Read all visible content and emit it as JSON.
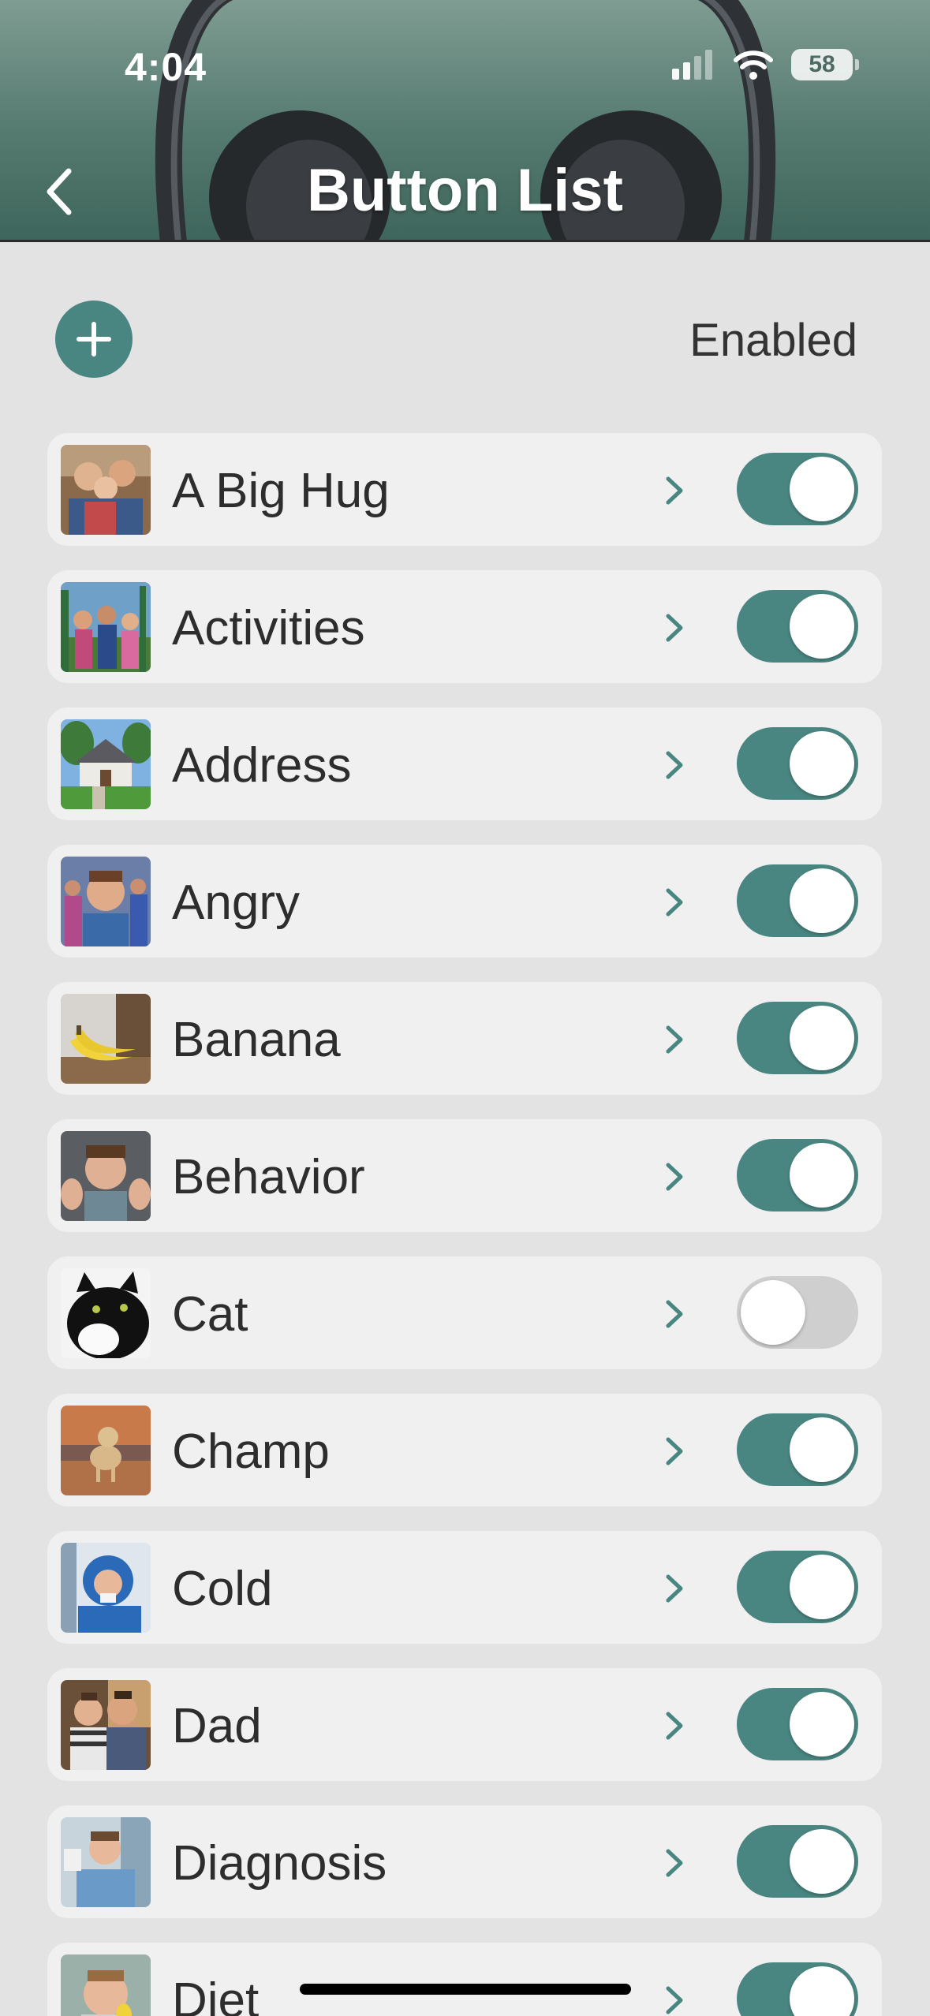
{
  "status_bar": {
    "time": "4:04",
    "battery": "58"
  },
  "header": {
    "title": "Button List"
  },
  "toolbar": {
    "enabled_label": "Enabled"
  },
  "buttons": [
    {
      "label": "A Big Hug",
      "enabled": true
    },
    {
      "label": "Activities",
      "enabled": true
    },
    {
      "label": "Address",
      "enabled": true
    },
    {
      "label": "Angry",
      "enabled": true
    },
    {
      "label": "Banana",
      "enabled": true
    },
    {
      "label": "Behavior",
      "enabled": true
    },
    {
      "label": "Cat",
      "enabled": false
    },
    {
      "label": "Champ",
      "enabled": true
    },
    {
      "label": "Cold",
      "enabled": true
    },
    {
      "label": "Dad",
      "enabled": true
    },
    {
      "label": "Diagnosis",
      "enabled": true
    },
    {
      "label": "Diet",
      "enabled": true
    }
  ],
  "colors": {
    "accent": "#4a8681",
    "header": "#557a70",
    "background": "#e3e3e3",
    "row": "#f0f0f0"
  },
  "icons": [
    "back-chevron-icon",
    "plus-icon",
    "chevron-right-icon",
    "signal-icon",
    "wifi-icon",
    "battery-icon"
  ]
}
